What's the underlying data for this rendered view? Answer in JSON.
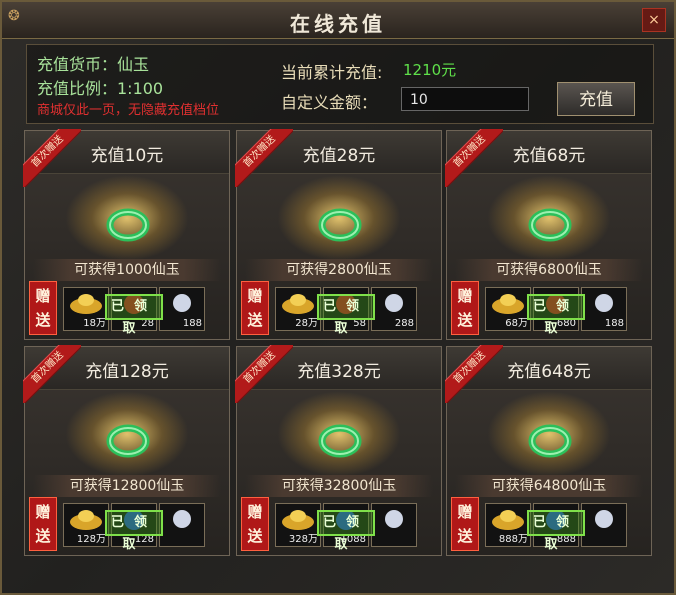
{
  "window": {
    "title": "在线充值",
    "close_label": "×",
    "logo": "logo-icon"
  },
  "info": {
    "currency_label": "充值货币：仙玉",
    "ratio_label": "充值比例：1:100",
    "notice": "商城仅此一页，无隐藏充值档位",
    "total_label": "当前累计充值:",
    "total_value": "1210元",
    "amount_label": "自定义金额：",
    "amount_value": "10",
    "pay_button": "充值"
  },
  "cards": [
    {
      "ribbon": "首次赠送",
      "title": "充值10元",
      "gain": "可获得1000仙玉",
      "gift": "赠送",
      "claimed": "已领取",
      "slots": [
        "18万",
        "28",
        "188"
      ],
      "item_icon": "jade-ring-icon",
      "item3_icon": "white-sparkle-icon"
    },
    {
      "ribbon": "首次赠送",
      "title": "充值28元",
      "gain": "可获得2800仙玉",
      "gift": "赠送",
      "claimed": "已领取",
      "slots": [
        "28万",
        "58",
        "288"
      ],
      "item_icon": "jade-rings-icon",
      "item3_icon": "white-sparkle-icon"
    },
    {
      "ribbon": "首次赠送",
      "title": "充值68元",
      "gain": "可获得6800仙玉",
      "gift": "赠送",
      "claimed": "已领取",
      "slots": [
        "68万",
        "680",
        "188"
      ],
      "item_icon": "jade-bag-icon",
      "item3_icon": "blue-orb-icon"
    },
    {
      "ribbon": "首次赠送",
      "title": "充值128元",
      "gain": "可获得12800仙玉",
      "gift": "赠送",
      "claimed": "已领取",
      "slots": [
        "128万",
        "128",
        ""
      ],
      "item_icon": "jade-bags-icon",
      "item3_icon": "scroll-icon"
    },
    {
      "ribbon": "首次赠送",
      "title": "充值328元",
      "gain": "可获得32800仙玉",
      "gift": "赠送",
      "claimed": "已领取",
      "slots": [
        "328万",
        "1088",
        ""
      ],
      "item_icon": "treasure-chest-icon",
      "item3_icon": "character-portrait-icon"
    },
    {
      "ribbon": "首次赠送",
      "title": "充值648元",
      "gain": "可获得64800仙玉",
      "gift": "赠送",
      "claimed": "已领取",
      "slots": [
        "888万",
        "888",
        ""
      ],
      "item_icon": "treasure-chests-icon",
      "item3_icon": "glowing-orb-icon"
    }
  ]
}
